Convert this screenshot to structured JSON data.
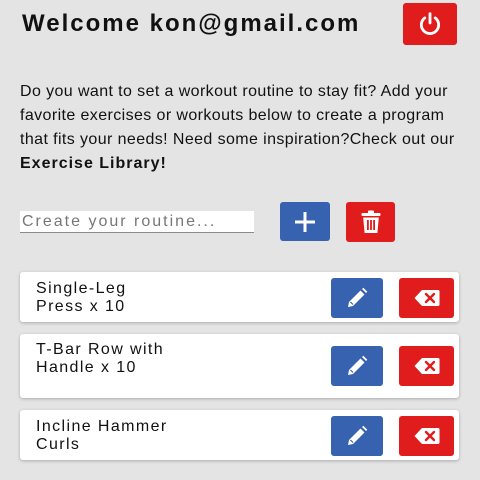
{
  "header": {
    "welcome_text": "Welcome kon@gmail.com"
  },
  "intro": {
    "text": "Do you want to set a workout routine to stay fit? Add your favorite exercises or workouts below to create a program that fits your needs! Need some inspiration?Check out our ",
    "link_text": "Exercise Library!"
  },
  "routine_form": {
    "input_value": "",
    "input_placeholder": "Create your routine..."
  },
  "routines": [
    {
      "name": "Single-Leg Press x 10"
    },
    {
      "name": "T-Bar Row with Handle x 10"
    },
    {
      "name": "Incline Hammer Curls"
    }
  ],
  "colors": {
    "background": "#e4e4e4",
    "danger_red": "#e01c1c",
    "primary_blue": "#3762b0",
    "card": "#ffffff"
  },
  "icons": {
    "logout": "power-icon",
    "add": "plus-icon",
    "clear": "trash-icon",
    "edit": "pencil-icon",
    "delete": "backspace-x-icon"
  }
}
